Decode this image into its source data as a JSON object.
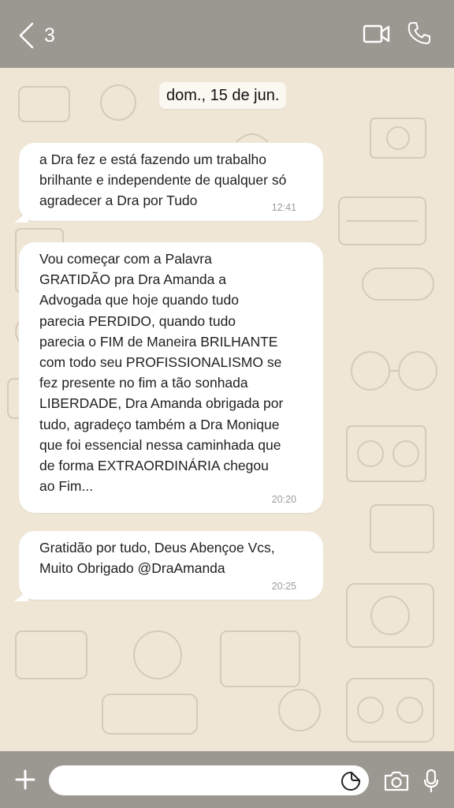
{
  "header": {
    "back_count": "3",
    "icons": [
      "chevron-left-icon",
      "video-camera-icon",
      "phone-icon"
    ]
  },
  "chat": {
    "date_label": "dom., 15 de jun.",
    "messages": [
      {
        "text": "a Dra fez e está fazendo um trabalho\nbrilhante e independente de qualquer só\nagradecer a Dra por Tudo",
        "time": "12:41"
      },
      {
        "text": "Vou começar com a Palavra\nGRATIDÃO pra Dra Amanda a\nAdvogada que hoje quando tudo\nparecia PERDIDO, quando tudo\nparecia o FIM de Maneira BRILHANTE\ncom todo seu PROFISSIONALISMO se\nfez presente no fim a tão sonhada\nLIBERDADE, Dra Amanda obrigada por\ntudo, agradeço também a Dra Monique\nque foi essencial nessa caminhada que\nde forma EXTRAORDINÁRIA chegou\nao Fim...",
        "time": "20:20"
      },
      {
        "text": "Gratidão por tudo, Deus Abençoe Vcs,\nMuito Obrigado @DraAmanda",
        "time": "20:25"
      }
    ]
  },
  "composer": {
    "input_value": "",
    "icons": [
      "plus-icon",
      "sticker-icon",
      "camera-icon",
      "microphone-icon"
    ]
  },
  "colors": {
    "bar": "#9b9891",
    "wallpaper": "#efe6d6",
    "bubble": "#ffffff",
    "doodle": "#d6cbb8"
  }
}
